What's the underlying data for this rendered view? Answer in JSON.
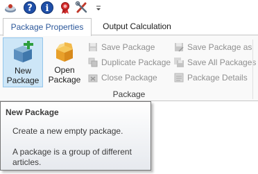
{
  "qat": {
    "items": [
      {
        "icon": "app-logo-icon"
      },
      {
        "icon": "help-icon"
      },
      {
        "icon": "info-icon"
      },
      {
        "icon": "ribbon-award-icon"
      },
      {
        "icon": "tools-icon"
      },
      {
        "icon": "customize-dropdown-icon"
      }
    ]
  },
  "tabs": [
    {
      "label": "Package Properties",
      "active": true
    },
    {
      "label": "Output Calculation",
      "active": false
    }
  ],
  "ribbon": {
    "big_buttons": [
      {
        "label_line1": "New",
        "label_line2": "Package",
        "icon": "new-package-icon"
      },
      {
        "label_line1": "Open",
        "label_line2": "Package",
        "icon": "open-package-icon"
      }
    ],
    "small_buttons": [
      {
        "label": "Save Package",
        "icon": "save-icon",
        "enabled": false
      },
      {
        "label": "Duplicate Package",
        "icon": "duplicate-icon",
        "enabled": false
      },
      {
        "label": "Close Package",
        "icon": "close-package-icon",
        "enabled": false
      },
      {
        "label": "Save Package as",
        "icon": "save-as-icon",
        "enabled": false
      },
      {
        "label": "Save All Packages",
        "icon": "save-all-icon",
        "enabled": false
      },
      {
        "label": "Package Details",
        "icon": "details-icon",
        "enabled": false
      }
    ],
    "group_label": "Package"
  },
  "tooltip": {
    "title": "New Package",
    "description": "Create a new empty package.",
    "more": "A package is a group of different articles."
  },
  "colors": {
    "accent": "#2b579a",
    "hover_bg": "#cde6f7",
    "disabled_text": "#8f8f8f"
  }
}
